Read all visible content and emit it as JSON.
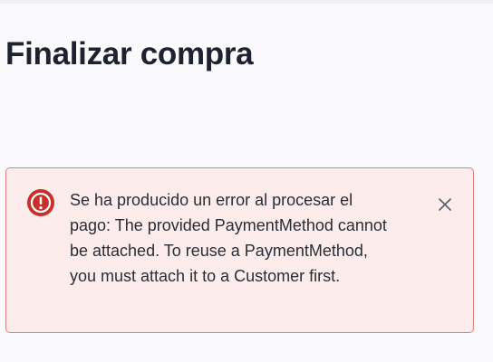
{
  "page": {
    "title": "Finalizar compra"
  },
  "alert": {
    "type": "error",
    "icon": "error-circle-icon",
    "message": "Se ha producido un error al procesar el pago: The provided PaymentMethod cannot be attached. To reuse a PaymentMethod, you must attach it to a Customer first.",
    "close_icon": "close-icon",
    "colors": {
      "background": "#fcecec",
      "border": "#d7807f",
      "icon": "#c8302b"
    }
  }
}
